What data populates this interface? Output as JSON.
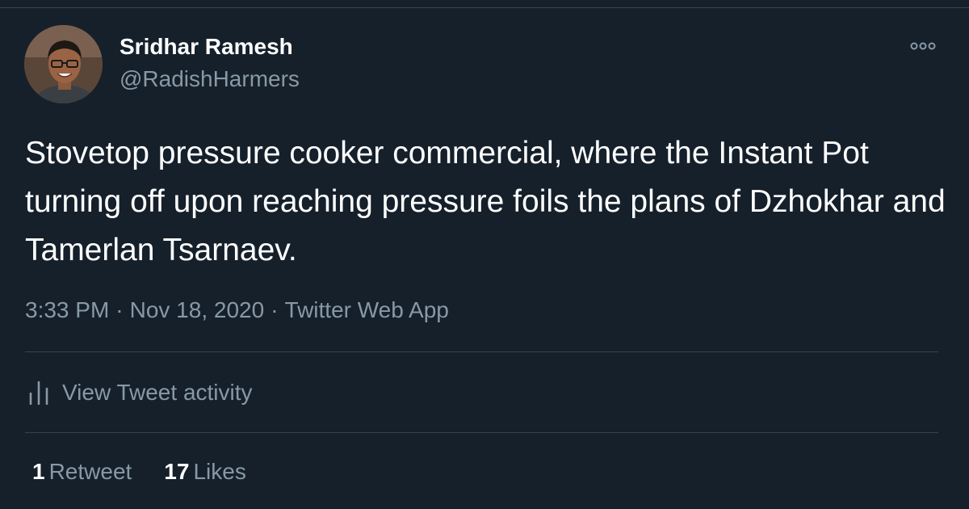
{
  "tweet": {
    "author": {
      "name": "Sridhar Ramesh",
      "handle": "@RadishHarmers",
      "avatar_icon": "profile-photo"
    },
    "more_icon": "more-options-icon",
    "text": "Stovetop pressure cooker commercial, where the Instant Pot turning off upon reaching pressure foils the plans of Dzhokhar and Tamerlan Tsarnaev.",
    "time": "3:33 PM",
    "separator": "·",
    "date": "Nov 18, 2020",
    "source": "Twitter Web App",
    "activity": {
      "icon": "analytics-bar-icon",
      "label": "View Tweet activity"
    },
    "stats": {
      "retweets_count": "1",
      "retweets_label": "Retweet",
      "likes_count": "17",
      "likes_label": "Likes"
    }
  },
  "colors": {
    "background": "#15202b",
    "primary_text": "#ffffff",
    "secondary_text": "#8899a6",
    "border": "#38444d"
  }
}
